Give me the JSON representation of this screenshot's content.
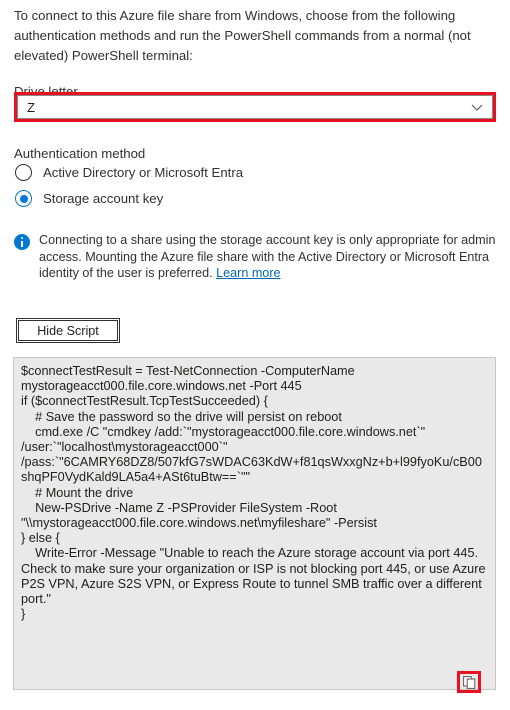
{
  "intro": {
    "text": "To connect to this Azure file share from Windows, choose from the following authentication methods and run the PowerShell commands from a normal (not elevated) PowerShell terminal:"
  },
  "drive_letter": {
    "label": "Drive letter",
    "value": "Z",
    "chevron_icon": "chevron-down-icon",
    "highlight_color": "#e81123"
  },
  "auth": {
    "label": "Authentication method",
    "options": [
      {
        "label": "Active Directory or Microsoft Entra",
        "selected": false
      },
      {
        "label": "Storage account key",
        "selected": true
      }
    ],
    "accent_color": "#0078d4"
  },
  "info": {
    "icon": "info-circle-icon",
    "text": "Connecting to a share using the storage account key is only appropriate for admin access. Mounting the Azure file share with the Active Directory or Microsoft Entra identity of the user is preferred. ",
    "link_label": "Learn more",
    "link_color": "#0067b8"
  },
  "toolbar": {
    "hide_script_label": "Hide Script"
  },
  "script": {
    "content": "$connectTestResult = Test-NetConnection -ComputerName mystorageacct000.file.core.windows.net -Port 445\nif ($connectTestResult.TcpTestSucceeded) {\n    # Save the password so the drive will persist on reboot\n    cmd.exe /C \"cmdkey /add:`\"mystorageacct000.file.core.windows.net`\" /user:`\"localhost\\mystorageacct000`\" /pass:`\"6CAMRY68DZ8/507kfG7sWDAC63KdW+f81qsWxxgNz+b+l99fyoKu/cB00shqPF0VydKald9LA5a4+ASt6tuBtw==`\"\"\n    # Mount the drive\n    New-PSDrive -Name Z -PSProvider FileSystem -Root \"\\\\mystorageacct000.file.core.windows.net\\myfileshare\" -Persist\n} else {\n    Write-Error -Message \"Unable to reach the Azure storage account via port 445. Check to make sure your organization or ISP is not blocking port 445, or use Azure P2S VPN, Azure S2S VPN, or Express Route to tunnel SMB traffic over a different port.\"\n}",
    "background": "#e9e9e9",
    "copy_icon": "copy-icon",
    "copy_highlight_color": "#e81123"
  }
}
